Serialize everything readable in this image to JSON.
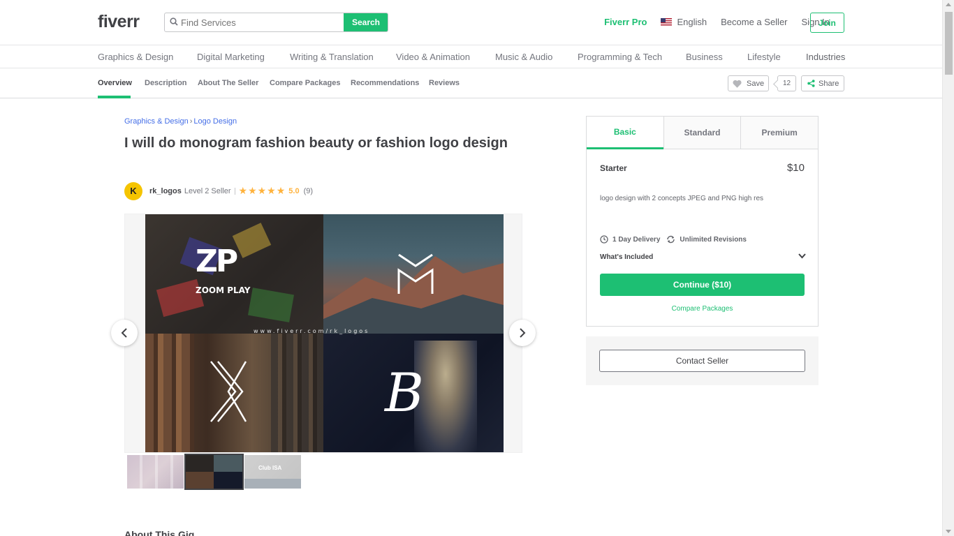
{
  "header": {
    "logo": "fiverr",
    "search_placeholder": "Find Services",
    "search_button": "Search",
    "fiverr_pro": "Fiverr Pro",
    "language": "English",
    "become_seller": "Become a Seller",
    "sign_in": "Sign In",
    "join": "Join"
  },
  "categories": [
    "Graphics & Design",
    "Digital Marketing",
    "Writing & Translation",
    "Video & Animation",
    "Music & Audio",
    "Programming & Tech",
    "Business",
    "Lifestyle",
    "Industries"
  ],
  "gig_nav": {
    "tabs": [
      "Overview",
      "Description",
      "About The Seller",
      "Compare Packages",
      "Recommendations",
      "Reviews"
    ],
    "active_tab": "Overview",
    "save_label": "Save",
    "save_count": "12",
    "share_label": "Share"
  },
  "breadcrumb": [
    "Graphics & Design",
    "Logo Design"
  ],
  "breadcrumb_sep": "›",
  "gig": {
    "title": "I will do monogram fashion beauty or fashion logo design",
    "seller_avatar": "K",
    "seller_name": "rk_logos",
    "seller_level": "Level 2 Seller",
    "stars": "★★★★★",
    "rating": "5.0",
    "reviews": "(9)"
  },
  "gallery": {
    "tile1_monogram": "ZP",
    "tile1_name": "ZOOM PLAY",
    "tile2_monogram": "M",
    "tile3_monogram": "K",
    "tile4_monogram": "B",
    "watermark": "www.fiverr.com/rk_logos",
    "thumb3_text": "Club ISA"
  },
  "about_title": "About This Gig",
  "package": {
    "tabs": [
      "Basic",
      "Standard",
      "Premium"
    ],
    "active_tab": "Basic",
    "name": "Starter",
    "price": "$10",
    "description": "logo design with 2 concepts JPEG and PNG high res",
    "delivery": "1 Day Delivery",
    "revisions": "Unlimited Revisions",
    "whats_included": "What's Included",
    "continue": "Continue ($10)",
    "compare": "Compare Packages"
  },
  "contact_seller": "Contact Seller",
  "colors": {
    "brand_green": "#1dbf73",
    "link_blue": "#446ee7",
    "star_yellow": "#ffb33e"
  }
}
